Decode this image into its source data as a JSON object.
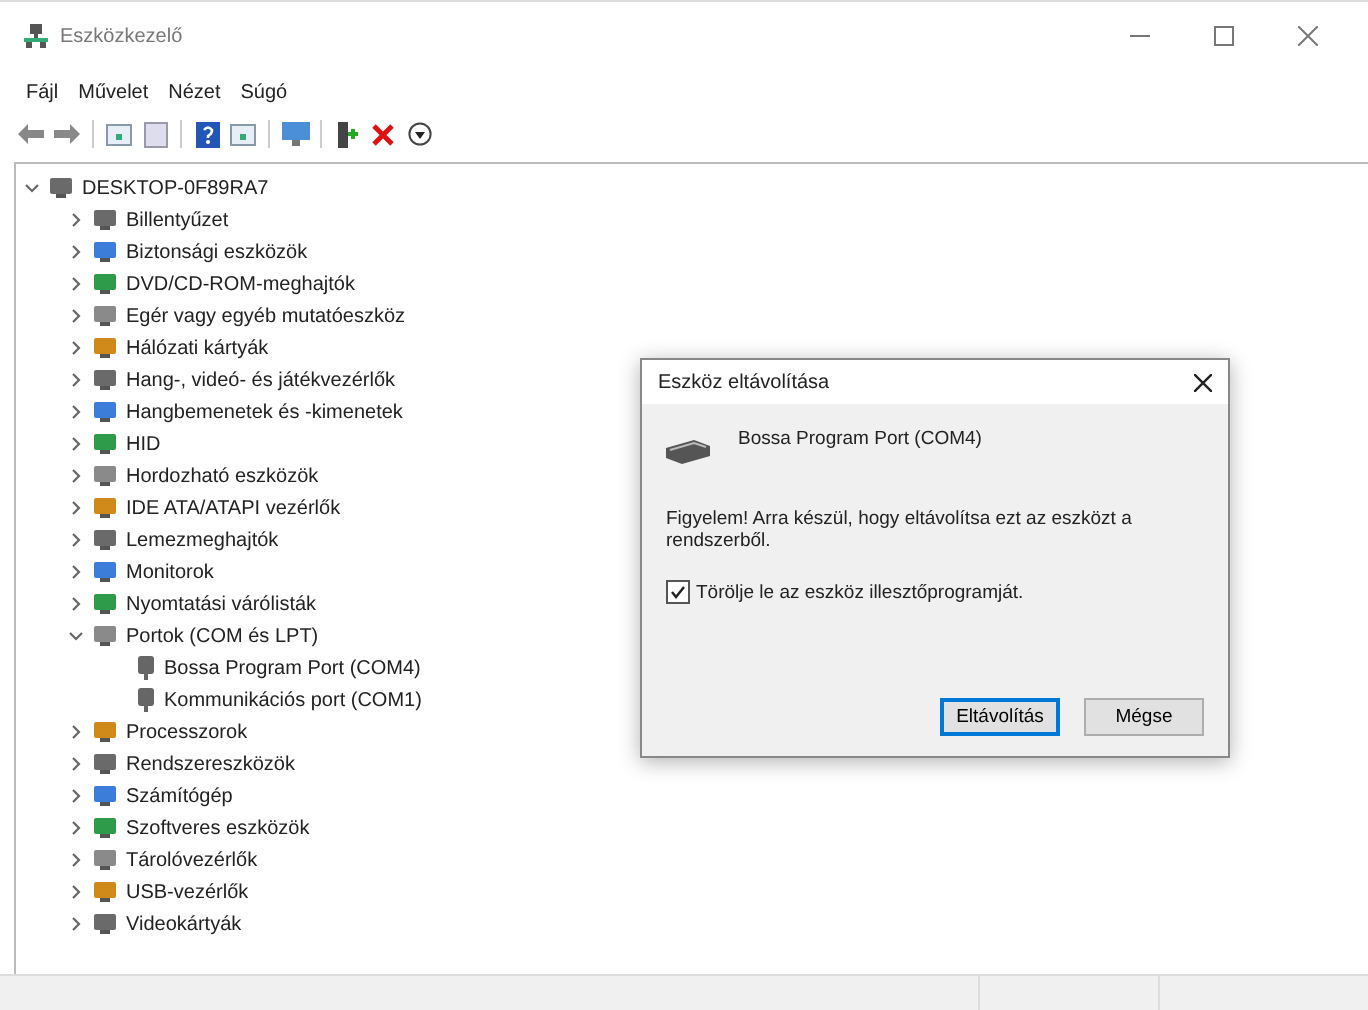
{
  "window": {
    "title": "Eszközkezelő"
  },
  "menu": [
    {
      "label": "Fájl"
    },
    {
      "label": "Művelet"
    },
    {
      "label": "Nézet"
    },
    {
      "label": "Súgó"
    }
  ],
  "tree": {
    "label": "DESKTOP-0F89RA7",
    "expanded": true,
    "children": [
      {
        "label": "Billentyűzet",
        "expanded": false
      },
      {
        "label": "Biztonsági eszközök",
        "expanded": false
      },
      {
        "label": "DVD/CD-ROM-meghajtók",
        "expanded": false
      },
      {
        "label": "Egér vagy egyéb mutatóeszköz",
        "expanded": false
      },
      {
        "label": "Hálózati kártyák",
        "expanded": false
      },
      {
        "label": "Hang-, videó- és játékvezérlők",
        "expanded": false
      },
      {
        "label": "Hangbemenetek és -kimenetek",
        "expanded": false
      },
      {
        "label": "HID",
        "expanded": false
      },
      {
        "label": "Hordozható eszközök",
        "expanded": false
      },
      {
        "label": "IDE ATA/ATAPI vezérlők",
        "expanded": false
      },
      {
        "label": "Lemezmeghajtók",
        "expanded": false
      },
      {
        "label": "Monitorok",
        "expanded": false
      },
      {
        "label": "Nyomtatási várólisták",
        "expanded": false
      },
      {
        "label": "Portok (COM és LPT)",
        "expanded": true,
        "children": [
          {
            "label": "Bossa Program Port (COM4)"
          },
          {
            "label": "Kommunikációs port (COM1)"
          }
        ]
      },
      {
        "label": "Processzorok",
        "expanded": false
      },
      {
        "label": "Rendszereszközök",
        "expanded": false
      },
      {
        "label": "Számítógép",
        "expanded": false
      },
      {
        "label": "Szoftveres eszközök",
        "expanded": false
      },
      {
        "label": "Tárolóvezérlők",
        "expanded": false
      },
      {
        "label": "USB-vezérlők",
        "expanded": false
      },
      {
        "label": "Videokártyák",
        "expanded": false
      }
    ]
  },
  "dialog": {
    "title": "Eszköz eltávolítása",
    "device": "Bossa Program Port (COM4)",
    "warning": "Figyelem! Arra készül, hogy eltávolítsa ezt az eszközt a rendszerből.",
    "checkbox": {
      "label": "Törölje le az eszköz illesztőprogramját.",
      "checked": true
    },
    "buttons": [
      {
        "label": "Eltávolítás",
        "default": true
      },
      {
        "label": "Mégse",
        "default": false
      }
    ]
  }
}
